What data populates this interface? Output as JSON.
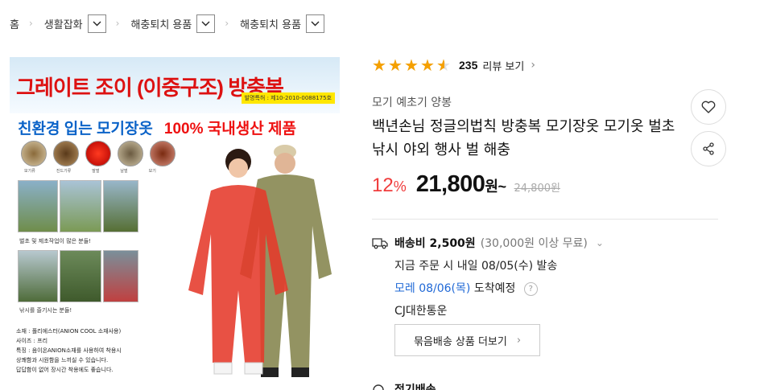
{
  "breadcrumb": {
    "home": "홈",
    "items": [
      "생활잡화",
      "해충퇴치 용품",
      "해충퇴치 용품"
    ]
  },
  "product_image": {
    "headline": "그레이트 조이 (이중구조) 방충복",
    "patent": "발명특허 : 제10-2010-0088175호",
    "sub_left": "친환경 입는 모기장옷",
    "sub_right": "100% 국내생산 제품",
    "bug_labels": [
      "모기류",
      "진드기류",
      "말벌",
      "날벌",
      "모기"
    ],
    "caption1": "벌초 및 제초작업이 많은 분들!",
    "caption2": "낚시를 즐기시는 분들!",
    "desc": [
      "소재 : 폴리에스터(ANION COOL 소재사용)",
      "사이즈 : 프리",
      "특징 : 음이온ANION소재를 사용하여 착용시",
      "       상쾌함과 시원함을 느끼실 수 있습니다.",
      "답답함이 없어 장시간 착용에도 좋습니다."
    ]
  },
  "rating": {
    "score": 4.5,
    "count": "235",
    "link_label": "리뷰 보기"
  },
  "brand": "모기 예초기 양봉",
  "title": "백년손님 정글의법칙 방충복 모기장옷 모기옷 벌초 낚시 야외 행사 벌 해충",
  "price": {
    "discount": "12",
    "discount_unit": "%",
    "sale": "21,800",
    "sale_unit": "원~",
    "original": "24,800원"
  },
  "shipping": {
    "fee": "배송비 2,500원",
    "note": "(30,000원 이상 무료)",
    "order_line": "지금 주문 시 내일 08/05(수) 발송",
    "arrival_date": "모레 08/06(목)",
    "arrival_suffix": "도착예정",
    "courier": "CJ대한통운",
    "bundle_button": "묶음배송 상품 더보기"
  },
  "next_section": "정기배송",
  "icons": [
    "like-icon",
    "share-icon",
    "truck-icon",
    "question-icon"
  ]
}
